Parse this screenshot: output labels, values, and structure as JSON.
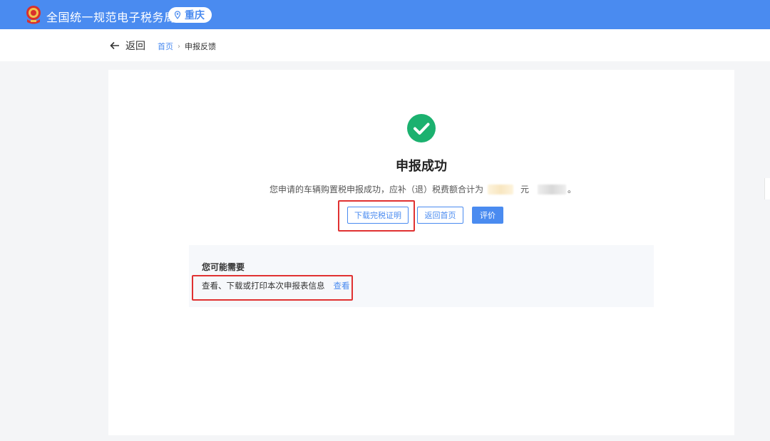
{
  "header": {
    "site_title": "全国统一规范电子税务局",
    "region": "重庆",
    "brand_color": "#4a8bf0"
  },
  "nav": {
    "back_label": "返回",
    "breadcrumb_home": "首页",
    "breadcrumb_sep": "›",
    "breadcrumb_current": "申报反馈"
  },
  "result": {
    "icon": "check-circle-icon",
    "icon_color": "#1bb16f",
    "title": "申报成功",
    "message_prefix": "您申请的车辆购置税申报成功，应补（退）税费额合计为",
    "message_unit": "元",
    "message_suffix": "。"
  },
  "actions": {
    "download_label": "下载完税证明",
    "home_label": "返回首页",
    "rate_label": "评价"
  },
  "needs": {
    "title": "您可能需要",
    "item_text": "查看、下载或打印本次申报表信息",
    "item_link": "查看"
  },
  "highlight_color": "#e03131"
}
